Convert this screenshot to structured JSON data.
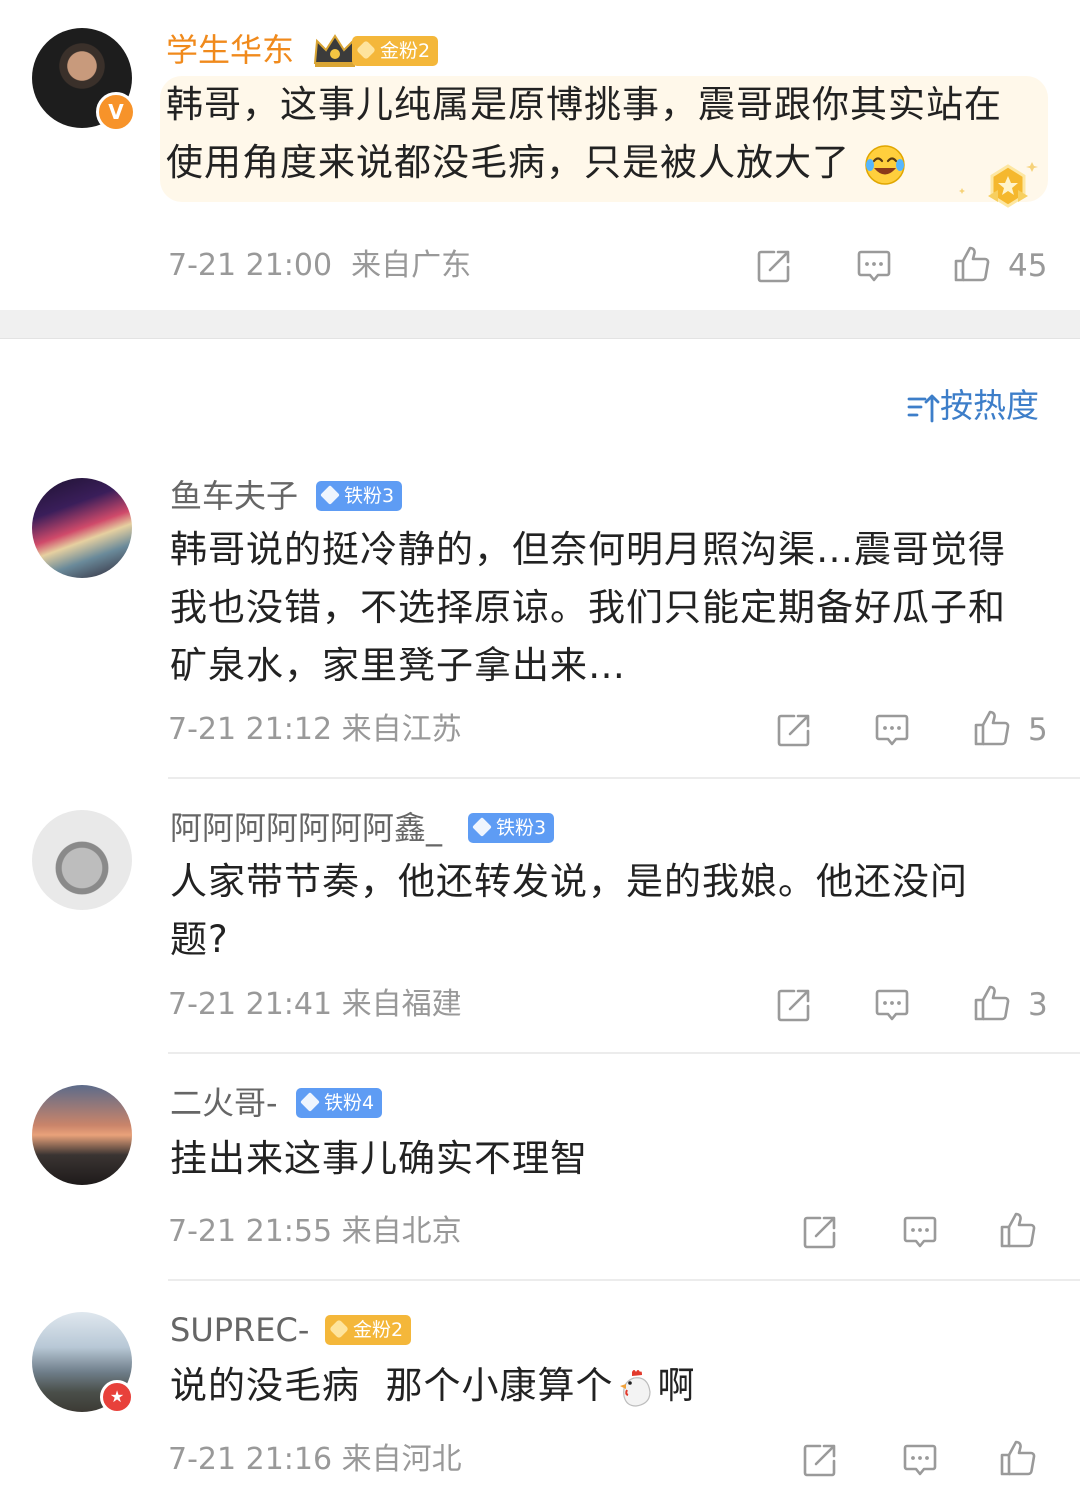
{
  "top_comment": {
    "username": "学生华东",
    "fan_badge": "金粉2",
    "content": [
      "韩哥，这事儿纯属是原博挑事，震哥跟你其实站在",
      "使用角度来说都没毛病，只是被人放大了"
    ],
    "emoji": "laughing-crying",
    "timestamp": "7-21 21:00",
    "location": "来自广东",
    "likes": "45"
  },
  "sort": {
    "label": "按热度"
  },
  "comments": [
    {
      "username": "鱼车夫子",
      "fan_badge": "铁粉3",
      "lines": [
        "韩哥说的挺冷静的，但奈何明月照沟渠…震哥觉得",
        "我也没错，不选择原谅。我们只能定期备好瓜子和",
        "矿泉水，家里凳子拿出来…"
      ],
      "timestamp": "7-21 21:12",
      "location": "来自江苏",
      "likes": "5"
    },
    {
      "username": "阿阿阿阿阿阿阿鑫_",
      "fan_badge": "铁粉3",
      "lines": [
        "人家带节奏，他还转发说，是的我娘。他还没问",
        "题?"
      ],
      "timestamp": "7-21 21:41",
      "location": "来自福建",
      "likes": "3"
    },
    {
      "username": "二火哥-",
      "fan_badge": "铁粉4",
      "lines": [
        "挂出来这事儿确实不理智"
      ],
      "timestamp": "7-21 21:55",
      "location": "来自北京",
      "likes": ""
    },
    {
      "username": "SUPREC-",
      "fan_badge": "金粉2",
      "text_before": "说的没毛病  那个小康算个",
      "text_after": "啊",
      "emoji": "chicken",
      "timestamp": "7-21 21:16",
      "location": "来自河北",
      "likes": ""
    }
  ],
  "icons": {
    "share": "share-icon",
    "comment": "comment-icon",
    "like": "thumbs-up-icon",
    "sort": "sort-icon"
  },
  "colors": {
    "gold_name": "#f08a1c",
    "iron_badge": "#5e9cf4",
    "gold_badge": "#f4b73a",
    "sort_link": "#3d7ec9",
    "meta_gray": "#999999"
  }
}
